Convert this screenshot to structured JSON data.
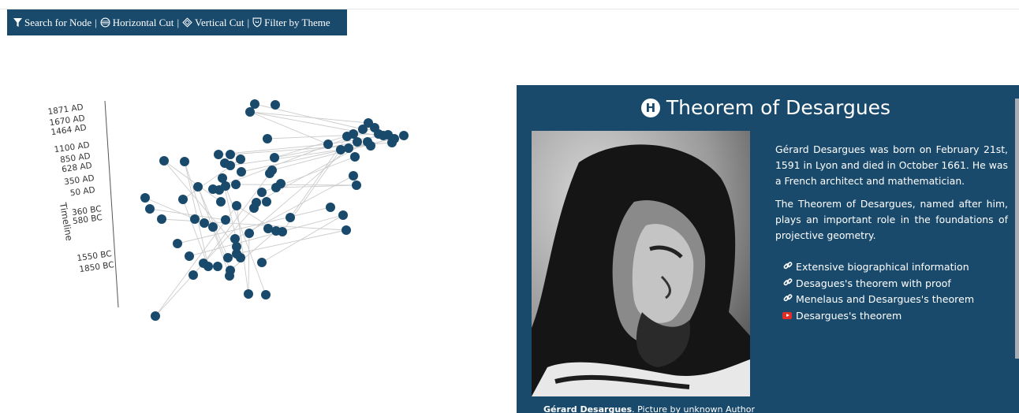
{
  "toolbar": {
    "search": "Search for Node",
    "hcut": "Horizontal Cut",
    "vcut": "Vertical Cut",
    "filter": "Filter by Theme",
    "separator": "|"
  },
  "timeline": {
    "label": "Timeline",
    "ticks": [
      "1871 AD",
      "1670 AD",
      "1464 AD",
      "1100 AD",
      "850 AD",
      "628 AD",
      "350 AD",
      "50 AD",
      "360 BC",
      "580 BC",
      "1550 BC",
      "1850 BC"
    ]
  },
  "detail": {
    "title": "Theorem of Desargues",
    "caption_name": "Gérard Desargues",
    "caption_rest": ". Picture by unknown Author",
    "paragraph1": "Gérard Desargues was born on February 21st, 1591 in Lyon and died in October 1661. He was a French architect and mathematician.",
    "paragraph2": "The Theorem of Desargues, named after him, plays an important role in the foundations of projective geometry.",
    "links": [
      {
        "label": "Extensive biographical information",
        "icon": "link-icon"
      },
      {
        "label": "Desagues's theorem with proof",
        "icon": "link-icon"
      },
      {
        "label": "Menelaus and Desargues's theorem",
        "icon": "link-icon"
      },
      {
        "label": "Desargues's theorem",
        "icon": "youtube-icon"
      }
    ]
  },
  "colors": {
    "accent": "#1a4a6b",
    "node": "#1a4a6b",
    "edge": "#cccccc",
    "youtube": "#e52d27"
  }
}
